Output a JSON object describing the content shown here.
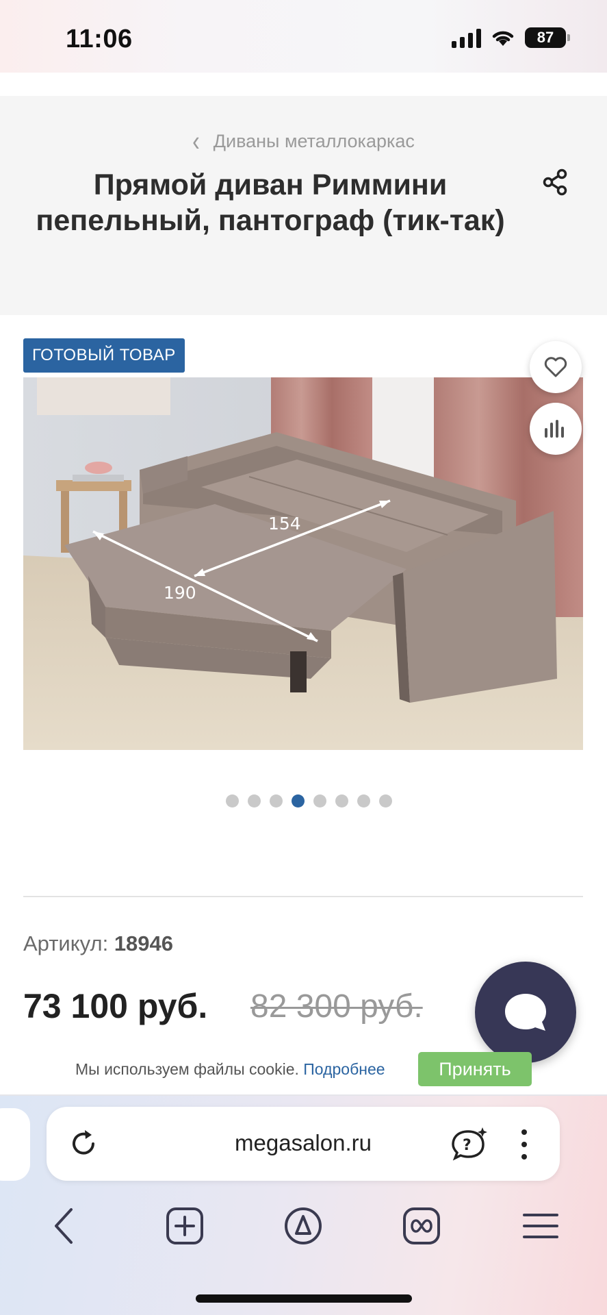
{
  "status_bar": {
    "time": "11:06",
    "battery": "87"
  },
  "header": {
    "breadcrumb": "Диваны металлокаркас",
    "title": "Прямой диван Риммини пепельный, пантограф (тик-так)"
  },
  "product": {
    "badge": "ГОТОВЫЙ ТОВАР",
    "photo": {
      "dimension_length": "154",
      "dimension_width": "190"
    },
    "gallery": {
      "total": 8,
      "active_index": 3
    },
    "sku_label": "Артикул:",
    "sku_value": "18946",
    "price": "73 100 руб.",
    "old_price": "82 300 руб."
  },
  "cookie_banner": {
    "text": "Мы используем файлы cookie.",
    "link": "Подробнее",
    "accept": "Принять"
  },
  "browser": {
    "url": "megasalon.ru",
    "icons": [
      "reload-icon",
      "alice-chat-icon",
      "more-icon",
      "back-icon",
      "new-tab-icon",
      "alice-icon",
      "tabs-icon",
      "menu-icon"
    ]
  },
  "colors": {
    "accent": "#2b64a1",
    "accept": "#7dc36b",
    "chat": "#373756"
  }
}
